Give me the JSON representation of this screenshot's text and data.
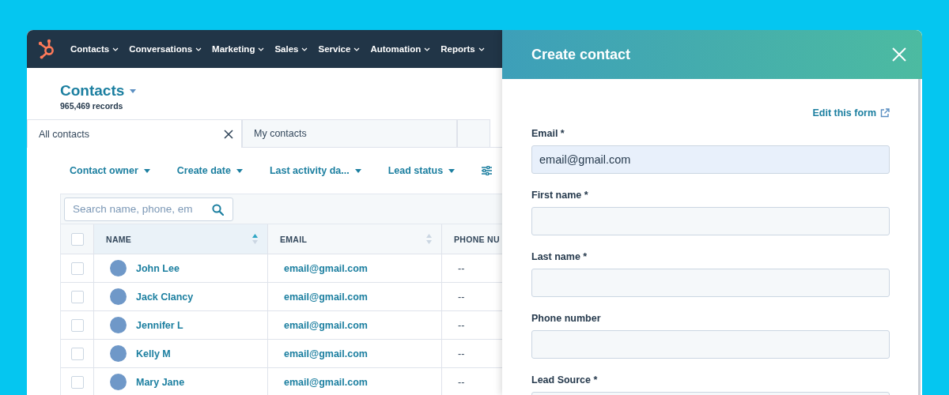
{
  "nav": {
    "items": [
      {
        "label": "Contacts"
      },
      {
        "label": "Conversations"
      },
      {
        "label": "Marketing"
      },
      {
        "label": "Sales"
      },
      {
        "label": "Service"
      },
      {
        "label": "Automation"
      },
      {
        "label": "Reports"
      }
    ]
  },
  "page": {
    "title": "Contacts",
    "records": "965,469 records"
  },
  "views": [
    {
      "label": "All contacts",
      "selected": true
    },
    {
      "label": "My contacts",
      "selected": false
    }
  ],
  "filters": [
    {
      "label": "Contact owner"
    },
    {
      "label": "Create date"
    },
    {
      "label": "Last activity da..."
    },
    {
      "label": "Lead status"
    }
  ],
  "search": {
    "placeholder": "Search name, phone, em"
  },
  "table": {
    "all_checked": false,
    "columns": [
      {
        "label": "NAME",
        "sorted": true
      },
      {
        "label": "EMAIL",
        "sorted": false
      },
      {
        "label": "PHONE NU"
      }
    ],
    "rows": [
      {
        "name": "John Lee",
        "email": "email@gmail.com",
        "phone": "--",
        "checked": false
      },
      {
        "name": "Jack Clancy",
        "email": "email@gmail.com",
        "phone": "--",
        "checked": false
      },
      {
        "name": "Jennifer L",
        "email": "email@gmail.com",
        "phone": "--",
        "checked": false
      },
      {
        "name": "Kelly M",
        "email": "email@gmail.com",
        "phone": "--",
        "checked": false
      },
      {
        "name": "Mary Jane",
        "email": "email@gmail.com",
        "phone": "--",
        "checked": false
      }
    ]
  },
  "panel": {
    "title": "Create contact",
    "edit_link": "Edit this form",
    "fields": [
      {
        "label": "Email *",
        "value": "email@gmail.com",
        "focused": true
      },
      {
        "label": "First name *",
        "focused": false
      },
      {
        "label": "Last name *",
        "focused": false
      },
      {
        "label": "Phone number",
        "focused": false
      },
      {
        "label": "Lead Source *",
        "focused": false
      }
    ]
  }
}
